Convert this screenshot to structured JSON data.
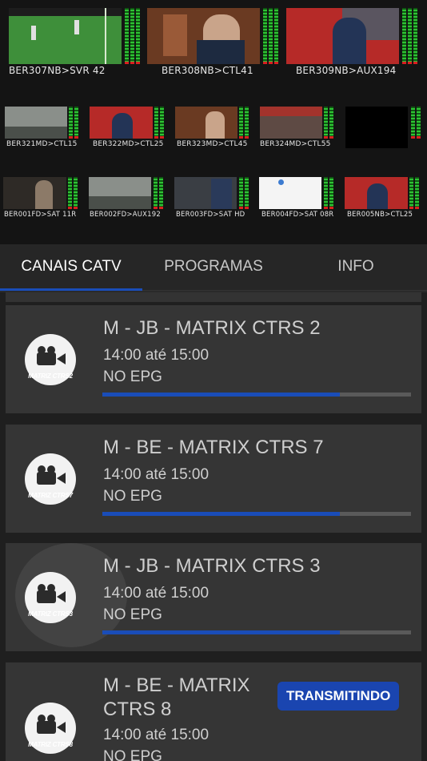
{
  "monitors": {
    "row1": [
      "BER307NB>SVR 42",
      "BER308NB>CTL41",
      "BER309NB>AUX194"
    ],
    "row2": [
      "BER321MD>CTL15",
      "BER322MD>CTL25",
      "BER323MD>CTL45",
      "BER324MD>CTL55",
      ""
    ],
    "row3": [
      "BER001FD>SAT 11R",
      "BER002FD>AUX192",
      "BER003FD>SAT HD",
      "BER004FD>SAT 08R",
      "BER005NB>CTL25"
    ]
  },
  "tabs": [
    "CANAIS CATV",
    "PROGRAMAS",
    "INFO"
  ],
  "colors": {
    "accent": "#1a4db8",
    "badge": "#1a45b0",
    "vu_green": "#2ec334",
    "vu_red": "#d82020"
  },
  "channels": [
    {
      "title": "M - JB - MATRIX CTRS 2",
      "time": "14:00 até 15:00",
      "epg": "NO EPG",
      "icon": "video-camera-icon",
      "icon_label": "MATRIZ CTRS2",
      "progress": 0.77
    },
    {
      "title": "M - BE - MATRIX CTRS 7",
      "time": "14:00 até 15:00",
      "epg": "NO EPG",
      "icon": "video-camera-icon",
      "icon_label": "MATRIZ CTRS7",
      "progress": 0.77
    },
    {
      "title": "M - JB - MATRIX CTRS 3",
      "time": "14:00 até 15:00",
      "epg": "NO EPG",
      "icon": "video-camera-icon",
      "icon_label": "MATRIZ CTRS3",
      "progress": 0.77
    },
    {
      "title_line1": "M - BE - MATRIX",
      "title_line2": "CTRS 8",
      "time": "14:00 até 15:00",
      "epg": "NO EPG",
      "icon": "video-camera-icon",
      "icon_label": "MATRIZ CTRS8",
      "badge": "TRANSMITINDO"
    }
  ]
}
